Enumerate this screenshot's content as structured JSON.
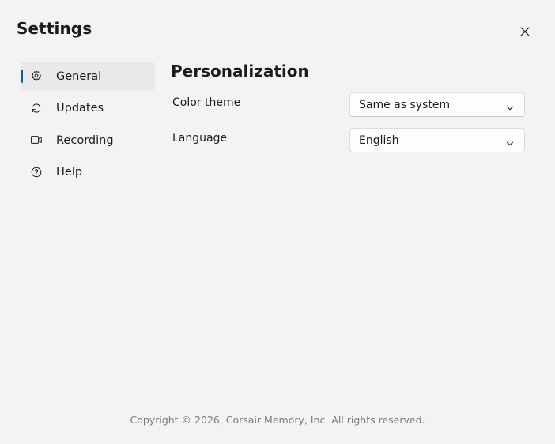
{
  "window": {
    "title": "Settings",
    "close_icon": "close-icon"
  },
  "sidebar": {
    "items": [
      {
        "label": "General",
        "icon": "gear-icon",
        "active": true
      },
      {
        "label": "Updates",
        "icon": "refresh-icon",
        "active": false
      },
      {
        "label": "Recording",
        "icon": "video-camera-icon",
        "active": false
      },
      {
        "label": "Help",
        "icon": "question-circle-icon",
        "active": false
      }
    ]
  },
  "main": {
    "section_title": "Personalization",
    "settings": [
      {
        "label": "Color theme",
        "value": "Same as system"
      },
      {
        "label": "Language",
        "value": "English"
      }
    ]
  },
  "footer": {
    "copyright": "Copyright © 2026, Corsair Memory, Inc. All rights reserved."
  },
  "colors": {
    "accent": "#005fb8",
    "background": "#f3f3f3",
    "active_item": "#e9e9e9"
  }
}
